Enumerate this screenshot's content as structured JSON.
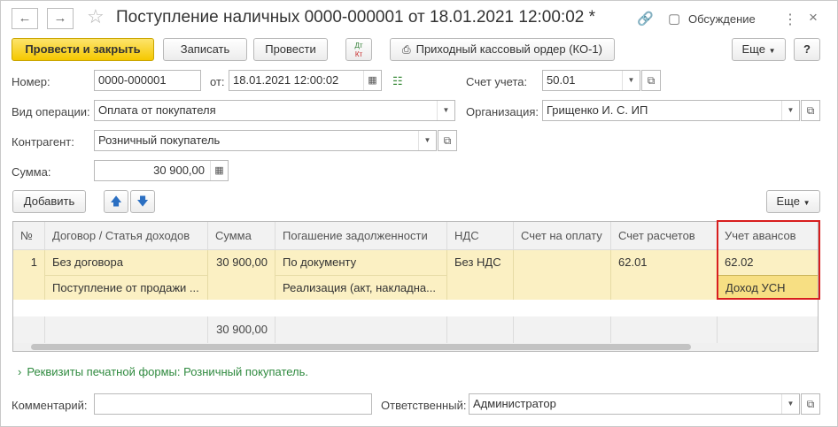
{
  "window": {
    "title": "Поступление наличных 0000-000001 от 18.01.2021 12:00:02 *",
    "discussion_label": "Обсуждение"
  },
  "icons": {
    "back": "arrow-left-icon",
    "forward": "arrow-right-icon",
    "favorite": "star-icon",
    "link": "link-icon",
    "discussion": "chat-icon",
    "more": "more-vertical-icon",
    "close": "close-icon",
    "calendar": "calendar-icon",
    "calculator": "calculator-icon",
    "open": "open-form-icon",
    "up": "arrow-up-icon",
    "down": "arrow-down-icon",
    "printer": "printer-icon"
  },
  "toolbar": {
    "post_close_label": "Провести и закрыть",
    "save_label": "Записать",
    "post_label": "Провести",
    "dt_kt_top": "Дт",
    "dt_kt_bottom": "Кт",
    "print_label": "Приходный кассовый ордер (КО-1)",
    "more_label": "Еще",
    "help_label": "?"
  },
  "form": {
    "number_label": "Номер:",
    "number_value": "0000-000001",
    "date_label": "от:",
    "date_value": "18.01.2021 12:00:02",
    "account_label": "Счет учета:",
    "account_value": "50.01",
    "operation_label": "Вид операции:",
    "operation_value": "Оплата от покупателя",
    "org_label": "Организация:",
    "org_value": "Грищенко И. С. ИП",
    "counterparty_label": "Контрагент:",
    "counterparty_value": "Розничный покупатель",
    "sum_label": "Сумма:",
    "sum_value": "30 900,00"
  },
  "table_toolbar": {
    "add_label": "Добавить",
    "more_label": "Еще"
  },
  "table": {
    "headers": [
      "№",
      "Договор / Статья доходов",
      "Сумма",
      "Погашение задолженности",
      "НДС",
      "Счет на оплату",
      "Счет расчетов",
      "Учет авансов"
    ],
    "row1": {
      "num": "1",
      "contract": "Без договора",
      "sum": "30 900,00",
      "repayment": "По документу",
      "vat": "Без НДС",
      "invoice": "",
      "settle_account": "62.01",
      "advance_account": "62.02"
    },
    "row2": {
      "contract": "Поступление от продажи ...",
      "repayment": "Реализация (акт, накладна...",
      "advance_account": "Доход УСН"
    },
    "total_sum": "30 900,00"
  },
  "footer": {
    "print_details_link": "Реквизиты печатной формы: Розничный покупатель.",
    "comment_label": "Комментарий:",
    "comment_value": "",
    "responsible_label": "Ответственный:",
    "responsible_value": "Администратор"
  },
  "colors": {
    "primary_button": "#f5c800",
    "selected_row": "#fbf0c3",
    "selected_cell": "#f7df83",
    "highlight_border": "#d81e1e",
    "link": "#2f8a3f"
  }
}
